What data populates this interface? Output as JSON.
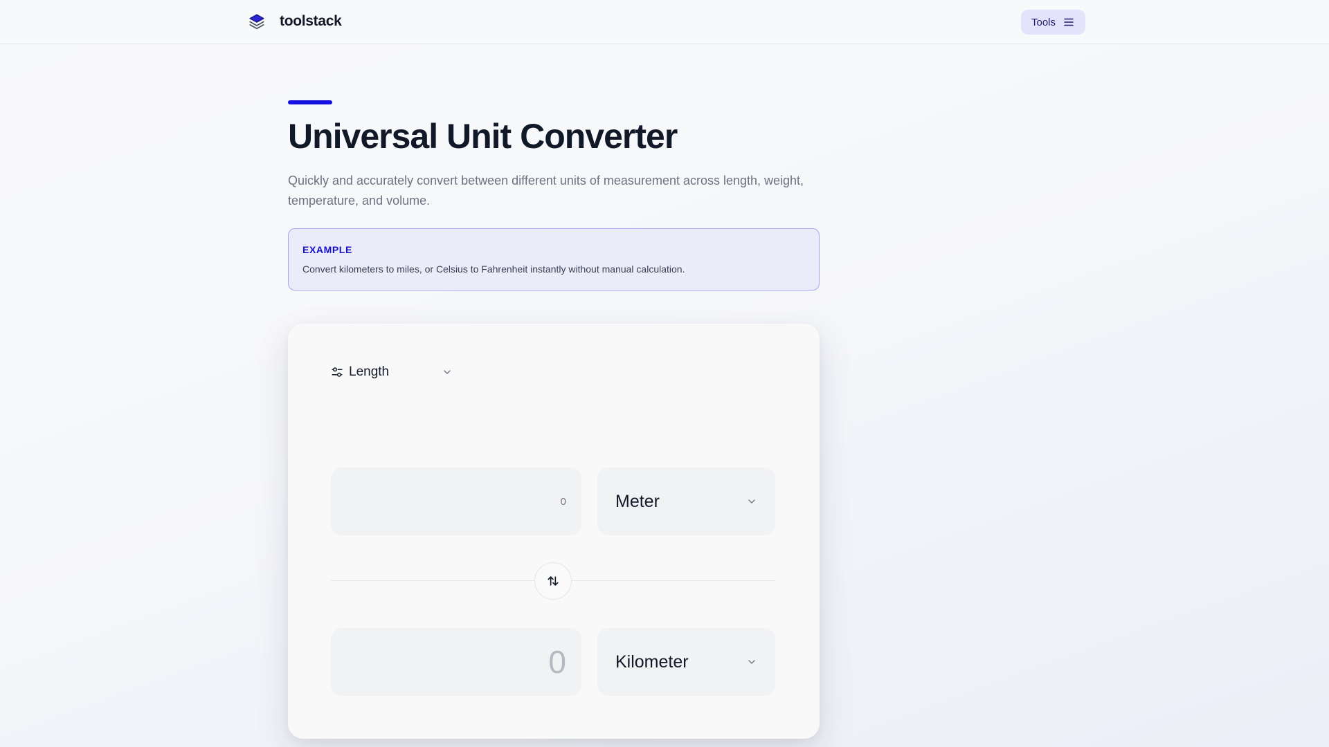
{
  "header": {
    "brand_name": "toolstack",
    "brand_icon": "layers-icon",
    "tools_label": "Tools",
    "tools_icon": "menu-icon"
  },
  "hero": {
    "title": "Universal Unit Converter",
    "description": "Quickly and accurately convert between different units of measurement across length, weight, temperature, and volume.",
    "accent_color": "#1411e0"
  },
  "example": {
    "tag": "EXAMPLE",
    "text": "Convert kilometers to miles, or Celsius to Fahrenheit instantly without manual calculation."
  },
  "converter": {
    "category_icon": "sliders-icon",
    "category": "Length",
    "from_placeholder": "0",
    "from_unit": "Meter",
    "swap_icon": "swap-vertical-icon",
    "to_value": "0",
    "to_unit": "Kilometer"
  }
}
